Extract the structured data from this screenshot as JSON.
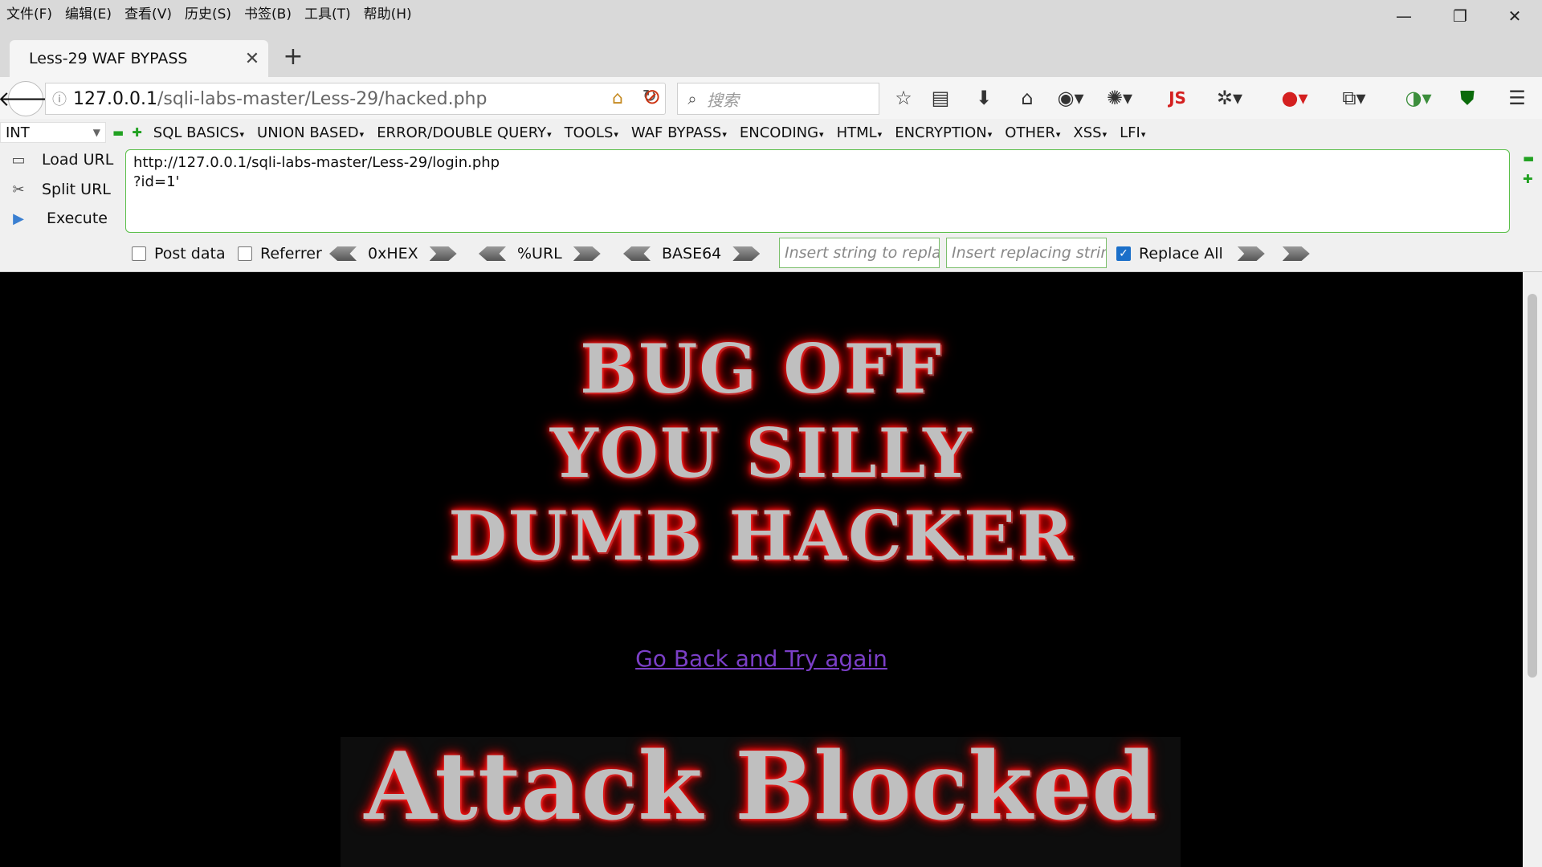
{
  "menubar": [
    "文件(F)",
    "编辑(E)",
    "查看(V)",
    "历史(S)",
    "书签(B)",
    "工具(T)",
    "帮助(H)"
  ],
  "tab": {
    "title": "Less-29 WAF BYPASS",
    "close": "✕",
    "new": "+"
  },
  "nav": {
    "url_host": "127.0.0.1",
    "url_path": "/sqli-labs-master/Less-29/hacked.php",
    "search_placeholder": "搜索"
  },
  "hackbar": {
    "select_value": "INT",
    "menu": [
      "SQL BASICS",
      "UNION BASED",
      "ERROR/DOUBLE QUERY",
      "TOOLS",
      "WAF BYPASS",
      "ENCODING",
      "HTML",
      "ENCRYPTION",
      "OTHER",
      "XSS",
      "LFI"
    ],
    "actions": {
      "load": "Load URL",
      "split": "Split URL",
      "execute": "Execute"
    },
    "text_lines": [
      "http://127.0.0.1/sqli-labs-master/Less-29/login.php",
      "?id=1'"
    ],
    "post_data": "Post data",
    "referrer": "Referrer",
    "hex": "0xHEX",
    "url": "%URL",
    "base64": "BASE64",
    "replace_placeholder": "Insert string to replace",
    "replacing_placeholder": "Insert replacing string",
    "replace_all": "Replace All",
    "replace_all_checked": true
  },
  "content": {
    "line1": "BUG OFF",
    "line2": "YOU SILLY",
    "line3": "DUMB HACKER",
    "link": "Go Back and Try again",
    "blocked": "Attack Blocked"
  }
}
